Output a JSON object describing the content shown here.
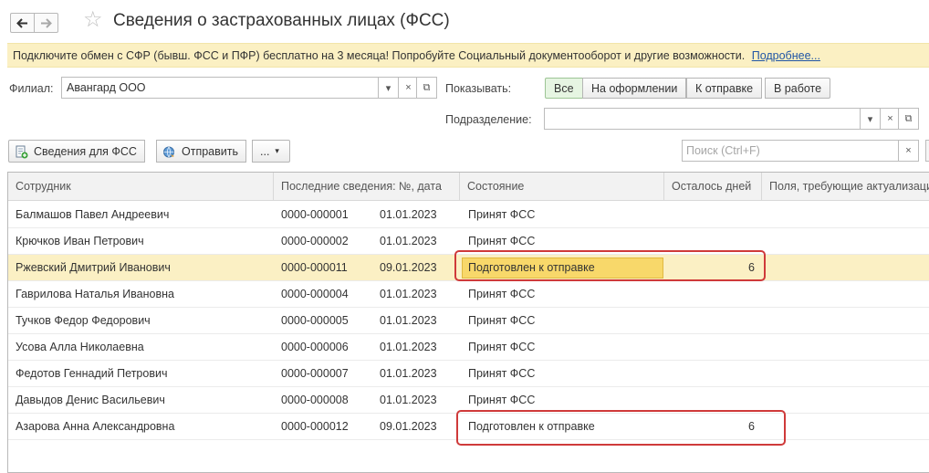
{
  "window": {
    "title": "Сведения о застрахованных лицах (ФСС)",
    "back_icon": "arrow-left-icon",
    "forward_icon": "arrow-right-icon",
    "favorite_icon": "star-icon"
  },
  "banner": {
    "text": "Подключите обмен с СФР (бывш. ФСС и ПФР) бесплатно на 3 месяца! Попробуйте Социальный документооборот и другие возможности.",
    "link": "Подробнее..."
  },
  "filters": {
    "branch_label": "Филиал:",
    "branch_value": "Авангард ООО",
    "show_label": "Показывать:",
    "show_options": [
      "Все",
      "На оформлении",
      "К отправке",
      "В работе"
    ],
    "show_selected": "Все",
    "division_label": "Подразделение:",
    "division_value": ""
  },
  "toolbar": {
    "info_button": "Сведения для ФСС",
    "send_button": "Отправить",
    "more_button": "...",
    "search_placeholder": "Поиск (Ctrl+F)",
    "clear_symbol": "×"
  },
  "field_buttons": {
    "dropdown": "▾",
    "clear": "×",
    "open": "⧉"
  },
  "table": {
    "columns": [
      "Сотрудник",
      "Последние сведения: №, дата",
      "Состояние",
      "Осталось дней",
      "Поля, требующие актуализации"
    ],
    "rows": [
      {
        "employee": "Балмашов Павел Андреевич",
        "number": "0000-000001",
        "date": "01.01.2023",
        "state": "Принят ФСС",
        "days": ""
      },
      {
        "employee": "Крючков Иван Петрович",
        "number": "0000-000002",
        "date": "01.01.2023",
        "state": "Принят ФСС",
        "days": ""
      },
      {
        "employee": "Ржевский Дмитрий Иванович",
        "number": "0000-000011",
        "date": "09.01.2023",
        "state": "Подготовлен к отправке",
        "days": "6"
      },
      {
        "employee": "Гаврилова Наталья Ивановна",
        "number": "0000-000004",
        "date": "01.01.2023",
        "state": "Принят ФСС",
        "days": ""
      },
      {
        "employee": "Тучков Федор Федорович",
        "number": "0000-000005",
        "date": "01.01.2023",
        "state": "Принят ФСС",
        "days": ""
      },
      {
        "employee": "Усова Алла Николаевна",
        "number": "0000-000006",
        "date": "01.01.2023",
        "state": "Принят ФСС",
        "days": ""
      },
      {
        "employee": "Федотов Геннадий Петрович",
        "number": "0000-000007",
        "date": "01.01.2023",
        "state": "Принят ФСС",
        "days": ""
      },
      {
        "employee": "Давыдов Денис Васильевич",
        "number": "0000-000008",
        "date": "01.01.2023",
        "state": "Принят ФСС",
        "days": ""
      },
      {
        "employee": "Азарова Анна Александровна",
        "number": "0000-000012",
        "date": "09.01.2023",
        "state": "Подготовлен к отправке",
        "days": "6"
      }
    ],
    "selected_row": 2
  },
  "colors": {
    "accent_selected_row": "#fbf0c4",
    "current_cell": "#f8d86a",
    "banner_bg": "#fbf0c3",
    "highlight": "#cf3a3a",
    "active_filter": "#e6f5e2"
  }
}
